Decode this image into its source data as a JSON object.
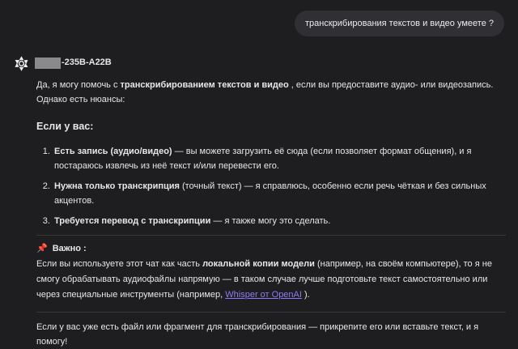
{
  "user_message": "транскрибирования текстов и видео умеете ?",
  "assistant": {
    "model_suffix": "-235B-A22B",
    "intro": {
      "p1": "Да, я могу помочь с ",
      "bold1": "транскрибированием текстов и видео",
      "p2": " , если вы предоставите аудио- или видеозапись. Однако есть нюансы:"
    },
    "heading": "Если у вас:",
    "items": [
      {
        "bold": "Есть запись (аудио/видео)",
        "text": " — вы можете загрузить её сюда (если позволяет формат общения), и я постараюсь извлечь из неё текст и/или перевести его."
      },
      {
        "bold": "Нужна только транскрипция",
        "text": " (точный текст) — я справлюсь, особенно если речь чёткая и без сильных акцентов."
      },
      {
        "bold": "Требуется перевод с транскрипции",
        "text": " — я также могу это сделать."
      }
    ],
    "note": {
      "title": "Важно :",
      "p1": "Если вы используете этот чат как часть ",
      "bold": "локальной копии модели",
      "p2": " (например, на своём компьютере), то я не смогу обрабатывать аудиофайлы напрямую — в таком случае лучше подготовьте текст самостоятельно или через специальные инструменты (например, ",
      "link": "Whisper от OpenAI",
      "p3": " )."
    },
    "final": "Если у вас уже есть файл или фрагмент для транскрибирования — прикрепите его или вставьте текст, и я помогу!"
  },
  "colors": {
    "background": "#1e1e20",
    "user_bubble": "#303034",
    "link": "#8b7cf5",
    "pin": "#e0443e"
  },
  "icons": {
    "logo": "qwen-logo-icon",
    "note": "pushpin-icon"
  }
}
